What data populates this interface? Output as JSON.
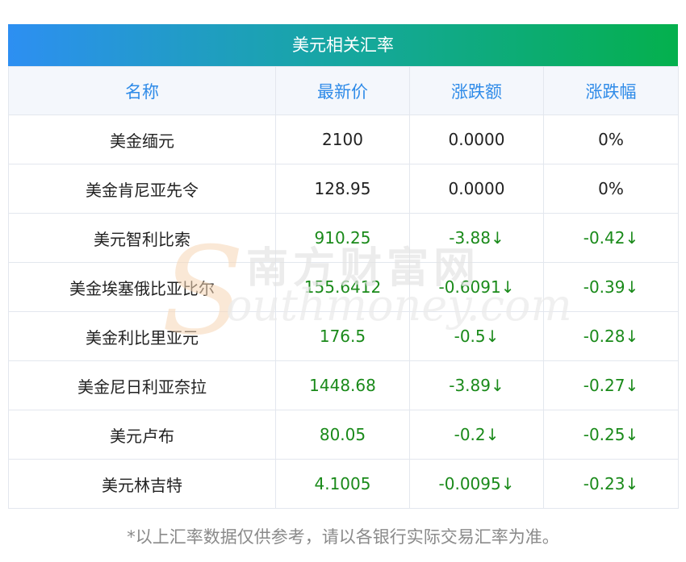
{
  "title": "美元相关汇率",
  "headers": [
    "名称",
    "最新价",
    "涨跌额",
    "涨跌幅"
  ],
  "rows": [
    {
      "name": "美金缅元",
      "price": "2100",
      "change": "0.0000",
      "pct": "0%",
      "trend": "flat"
    },
    {
      "name": "美金肯尼亚先令",
      "price": "128.95",
      "change": "0.0000",
      "pct": "0%",
      "trend": "flat"
    },
    {
      "name": "美元智利比索",
      "price": "910.25",
      "change": "-3.88↓",
      "pct": "-0.42↓",
      "trend": "down"
    },
    {
      "name": "美金埃塞俄比亚比尔",
      "price": "155.6412",
      "change": "-0.6091↓",
      "pct": "-0.39↓",
      "trend": "down"
    },
    {
      "name": "美金利比里亚元",
      "price": "176.5",
      "change": "-0.5↓",
      "pct": "-0.28↓",
      "trend": "down"
    },
    {
      "name": "美金尼日利亚奈拉",
      "price": "1448.68",
      "change": "-3.89↓",
      "pct": "-0.27↓",
      "trend": "down"
    },
    {
      "name": "美元卢布",
      "price": "80.05",
      "change": "-0.2↓",
      "pct": "-0.25↓",
      "trend": "down"
    },
    {
      "name": "美元林吉特",
      "price": "4.1005",
      "change": "-0.0095↓",
      "pct": "-0.23↓",
      "trend": "down"
    }
  ],
  "footnote": "*以上汇率数据仅供参考，请以各银行实际交易汇率为准。",
  "watermark": {
    "cn": "南方财富网",
    "en": "outhmoney.com",
    "letter": "S"
  },
  "colors": {
    "header_text": "#2f8be8",
    "down": "#1a8a1a",
    "title_gradient_start": "#2d8ff2",
    "title_gradient_end": "#04b04d"
  }
}
